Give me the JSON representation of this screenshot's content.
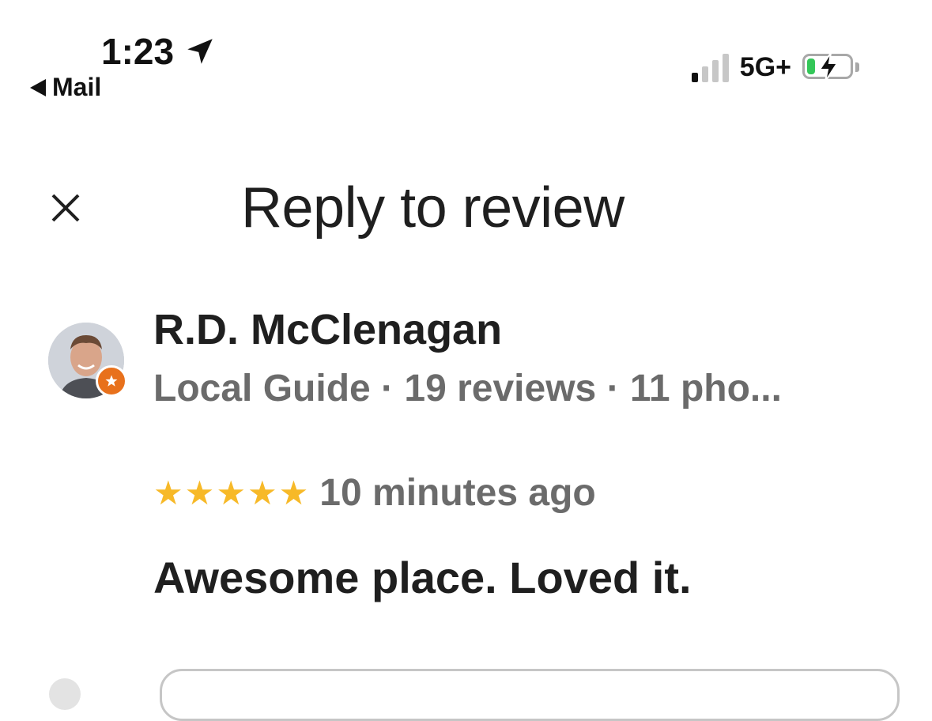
{
  "status_bar": {
    "time": "1:23",
    "back_label": "Mail",
    "network": "5G+",
    "signal_bars_on": 1,
    "signal_bars_total": 4,
    "battery_level": 0.15,
    "battery_color": "#34c759"
  },
  "header": {
    "title": "Reply to review",
    "close_icon": "close-icon"
  },
  "review": {
    "reviewer_name": "R.D. McClenagan",
    "reviewer_meta": "Local Guide · 19 reviews · 11 pho...",
    "rating": 5,
    "stars": [
      "★",
      "★",
      "★",
      "★",
      "★"
    ],
    "star_color": "#f7b928",
    "time_ago": "10 minutes ago",
    "text": "Awesome place. Loved it."
  },
  "colors": {
    "badge": "#e8711c",
    "text_primary": "#1f1f1f",
    "text_secondary": "#6b6b6b"
  }
}
